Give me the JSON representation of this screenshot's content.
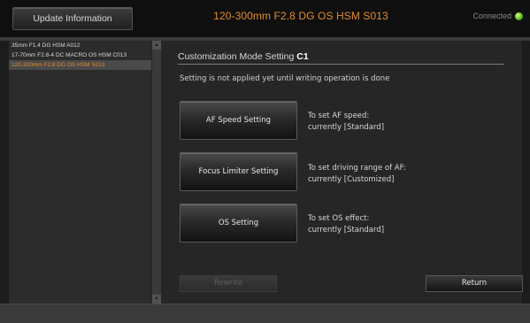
{
  "header": {
    "update_label": "Update Information",
    "lens_title": "120-300mm F2.8 DG OS HSM S013",
    "connection_status": "Connected",
    "connection_color": "#5bb31a"
  },
  "lens_list": {
    "items": [
      {
        "label": "35mm F1.4 DG HSM A012",
        "selected": false
      },
      {
        "label": "17-70mm F2.8-4 DC MACRO OS HSM C013",
        "selected": false
      },
      {
        "label": "120-300mm F2.8 DG OS HSM S013",
        "selected": true
      }
    ]
  },
  "main": {
    "section_title_prefix": "Customization Mode Setting",
    "section_title_mode": "C1",
    "notice": "Setting is not applied yet until writing operation is done",
    "settings": [
      {
        "button_label": "AF Speed Setting",
        "desc_line1": "To set AF speed:",
        "desc_line2": "currently [Standard]"
      },
      {
        "button_label": "Focus Limiter Setting",
        "desc_line1": "To set driving range of AF:",
        "desc_line2": "currently [Customized]"
      },
      {
        "button_label": "OS Setting",
        "desc_line1": "To set OS effect:",
        "desc_line2": "currently [Standard]"
      }
    ],
    "rewrite_label": "Rewrite",
    "return_label": "Return"
  },
  "colors": {
    "accent": "#e58a2e",
    "background": "#1c1c1c",
    "panel": "#262626"
  }
}
